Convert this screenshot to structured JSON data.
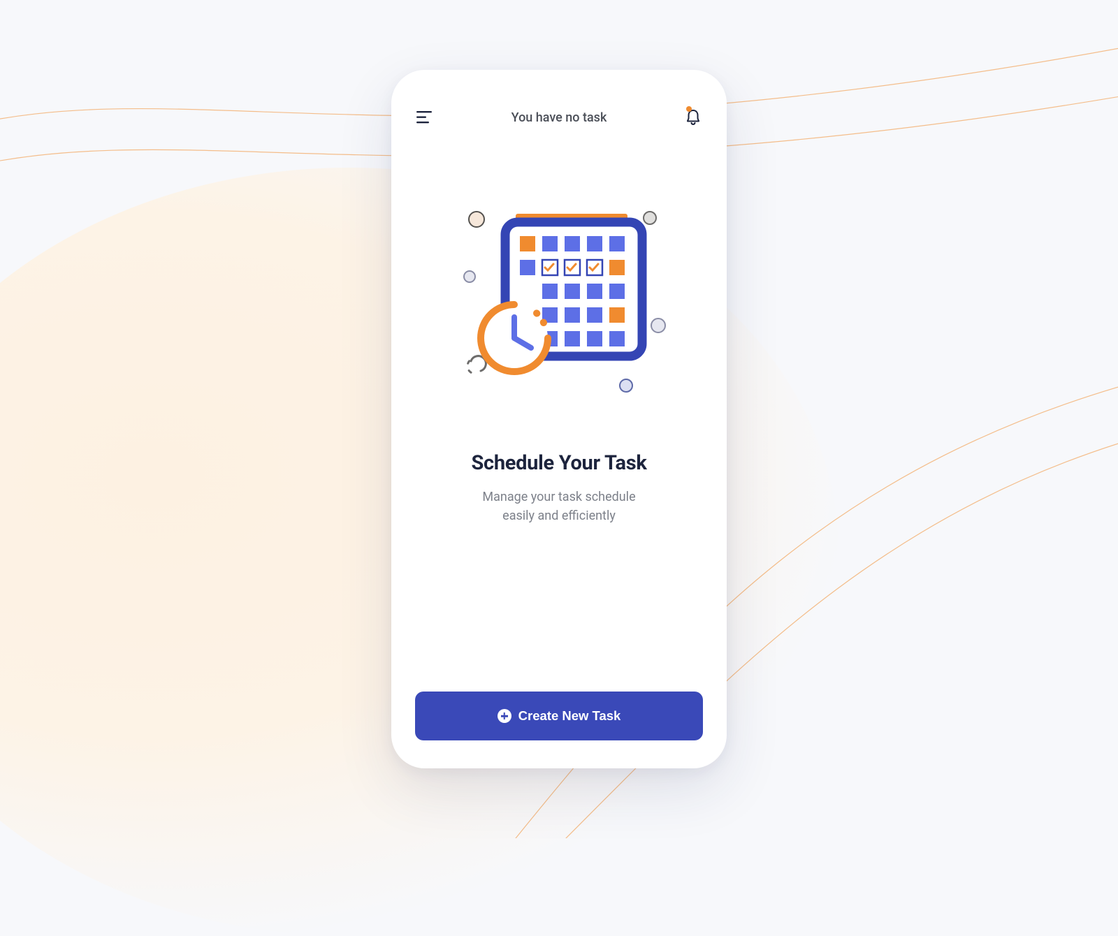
{
  "colors": {
    "accent_orange": "#f08b2f",
    "accent_blue": "#3a49b8",
    "calendar_cell_blue": "#5d6fe6",
    "text_dark": "#1d243d",
    "text_muted": "#7d818a",
    "background": "#f7f8fb",
    "blob": "#fdf1e2"
  },
  "header": {
    "title": "You have no task"
  },
  "empty_state": {
    "heading": "Schedule Your Task",
    "subheading_line1": "Manage your task schedule",
    "subheading_line2": "easily and efficiently",
    "illustration": "calendar-clock"
  },
  "cta": {
    "label": "Create New Task",
    "icon": "plus-circle-icon"
  }
}
